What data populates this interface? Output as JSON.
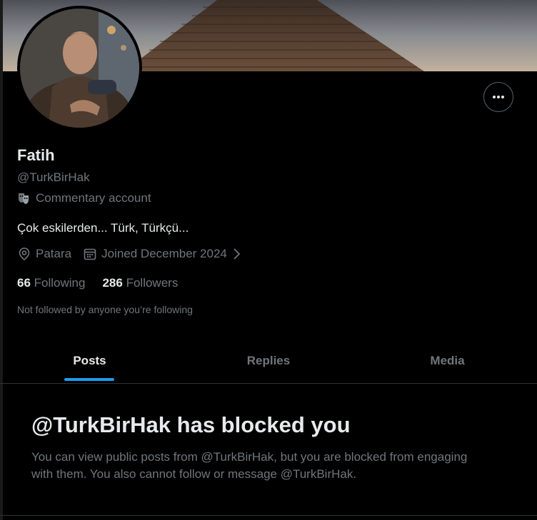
{
  "profile": {
    "name": "Fatih",
    "handle": "@TurkBirHak",
    "label": "Commentary account",
    "bio": "Çok eskilerden... Türk, Türkçü...",
    "location": "Patara",
    "joined": "Joined December 2024",
    "following_count": "66",
    "following_label": "Following",
    "followers_count": "286",
    "followers_label": "Followers",
    "not_followed_text": "Not followed by anyone you’re following"
  },
  "icons": {
    "label": "commentary-mask-icon",
    "more": "more-horizontal-icon",
    "location": "location-pin-icon",
    "calendar": "calendar-icon",
    "chevron": "chevron-right-icon"
  },
  "tabs": [
    {
      "label": "Posts",
      "active": true
    },
    {
      "label": "Replies",
      "active": false
    },
    {
      "label": "Media",
      "active": false
    }
  ],
  "blocked": {
    "title": "@TurkBirHak has blocked you",
    "description": "You can view public posts from @TurkBirHak, but you are blocked from engaging with them. You also cannot follow or message @TurkBirHak."
  },
  "colors": {
    "background": "#000000",
    "text_primary": "#e7e9ea",
    "text_secondary": "#71767b",
    "accent": "#1d9bf0",
    "border": "#2f3336"
  }
}
